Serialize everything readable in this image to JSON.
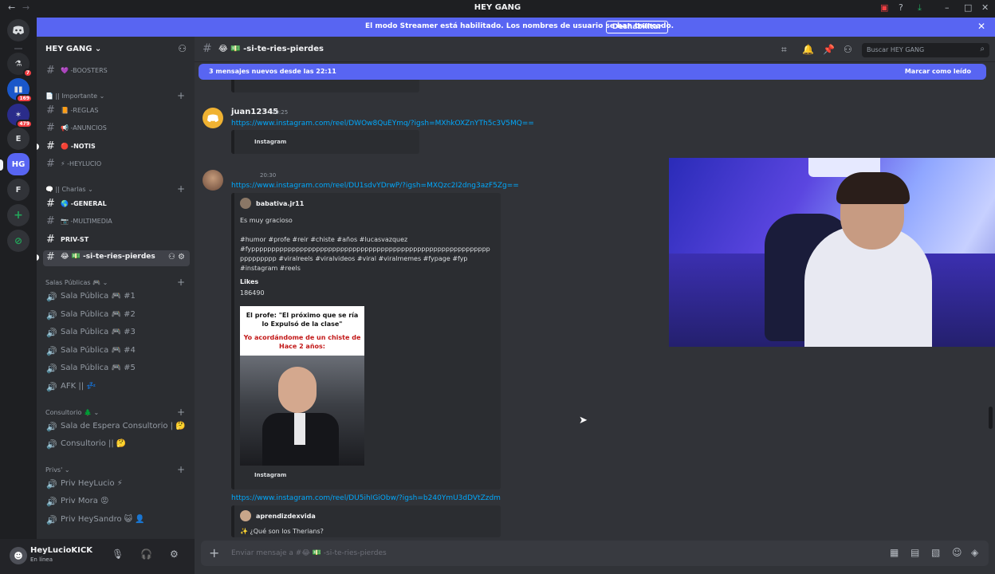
{
  "window": {
    "title": "HEY GANG"
  },
  "banner": {
    "text": "El modo Streamer está habilitado. Los nombres de usuario se han truncado.",
    "button": "Deshabilitar"
  },
  "rail": {
    "badges": [
      "7",
      "169",
      "479"
    ],
    "letters": [
      "E",
      "HG",
      "F"
    ]
  },
  "server": {
    "name": "HEY GANG ⌄"
  },
  "channels": {
    "boosters": "💜 -BOOSTERS",
    "cat_importante": "📄 || Importante ⌄",
    "reglas": "📙 -REGLAS",
    "anuncios": "📢 -ANUNCIOS",
    "notis": "🔴 -NOTIS",
    "heylucio": "⚡ -HEYLUCIO",
    "cat_charlas": "🗨️ || Charlas ⌄",
    "general": "🌎 -GENERAL",
    "multimedia": "📷 -MULTIMEDIA",
    "privst": "PRIV-ST",
    "sitereies": "😂 💵 -si-te-ries-pierdes",
    "cat_salas": "Salas Públicas 🎮 ⌄",
    "sala1": "Sala Pública 🎮 #1",
    "sala2": "Sala Pública 🎮 #2",
    "sala3": "Sala Pública 🎮 #3",
    "sala4": "Sala Pública 🎮 #4",
    "sala5": "Sala Pública 🎮 #5",
    "afk": "AFK || 💤",
    "cat_consultorio": "Consultorio 🌲 ⌄",
    "espera": "Sala de Espera Consultorio | 🤔",
    "consultorio": "Consultorio || 🤔",
    "cat_privs": "Privs' ⌄",
    "privlucio": "Priv HeyLucio ⚡",
    "privmora": "Priv Mora 😡",
    "privsandro": "Priv HeySandro 😺 👤"
  },
  "user": {
    "name": "HeyLucioKICK",
    "status": "En línea"
  },
  "header": {
    "channel": "😂 💵 -si-te-ries-pierdes",
    "search_placeholder": "Buscar HEY GANG"
  },
  "newbar": {
    "left": "3 mensajes nuevos desde las 22:11",
    "right": "Marcar como leído"
  },
  "messages": {
    "m1": {
      "user": "juan12345",
      "time": "20:25",
      "link": "https://www.instagram.com/reel/DWOw8QuEYmq/?igsh=MXhkOXZnYTh5c3V5MQ==",
      "embed_provider": "Instagram"
    },
    "m2": {
      "time": "20:30",
      "link": "https://www.instagram.com/reel/DU1sdvYDrwP/?igsh=MXQzc2I2dng3azF5Zg==",
      "author": "babativa.jr11",
      "desc": "Es muy gracioso",
      "tags1": "#humor #profe #reir #chiste #años #lucasvazquez",
      "tags2": "#fyppppppppppppppppppppppppppppppppppppppppppppppppppppppppppp",
      "tags3": "ppppppppp #viralreels #viralvideos #viral #viralmemes #fypage #fyp",
      "tags4": "#instagram #reels",
      "likes_label": "Likes",
      "likes_value": "186490",
      "meme_top": "El profe: \"El próximo que se ría lo Expulsó de la clase\"",
      "meme_bottom": "Yo acordándome de un chiste de Hace 2 años:",
      "embed_provider": "Instagram"
    },
    "m3": {
      "link": "https://www.instagram.com/reel/DU5ihIGiObw/?igsh=b240YmU3dDVtZzdm",
      "author": "aprendizdexvida",
      "desc": "✨ ¿Qué son los Therians?"
    }
  },
  "composer": {
    "placeholder": "Enviar mensaje a #😂 💵 -si-te-ries-pierdes"
  },
  "colors": {
    "blurple": "#5865f2",
    "link": "#00a8fc",
    "bg": "#313338",
    "sidebar": "#2b2d31"
  }
}
